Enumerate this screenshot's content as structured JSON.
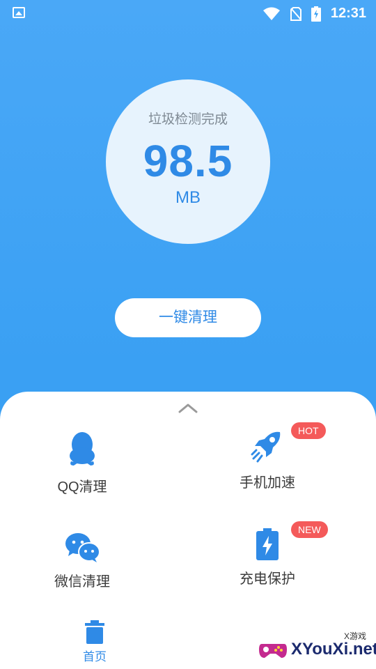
{
  "status_bar": {
    "time": "12:31",
    "icons": [
      "image-icon",
      "wifi-icon",
      "no-sim-icon",
      "battery-charging-icon"
    ]
  },
  "result": {
    "label": "垃圾检测完成",
    "value": "98.5",
    "unit": "MB"
  },
  "primary_action": {
    "label": "一键清理"
  },
  "features": [
    {
      "label": "QQ清理",
      "icon": "qq-penguin-icon"
    },
    {
      "label": "手机加速",
      "icon": "rocket-icon",
      "badge": "HOT"
    },
    {
      "label": "微信清理",
      "icon": "wechat-icon"
    },
    {
      "label": "充电保护",
      "icon": "battery-bolt-icon",
      "badge": "NEW"
    }
  ],
  "bottom_nav": {
    "home_label": "首页",
    "home_icon": "trash-can-icon"
  },
  "watermark": {
    "text": "XYouXi.net",
    "small_text": "X游戏"
  },
  "colors": {
    "background_blue": "#3aa0f3",
    "accent": "#2f8ae6",
    "badge_red": "#f45a5a"
  }
}
